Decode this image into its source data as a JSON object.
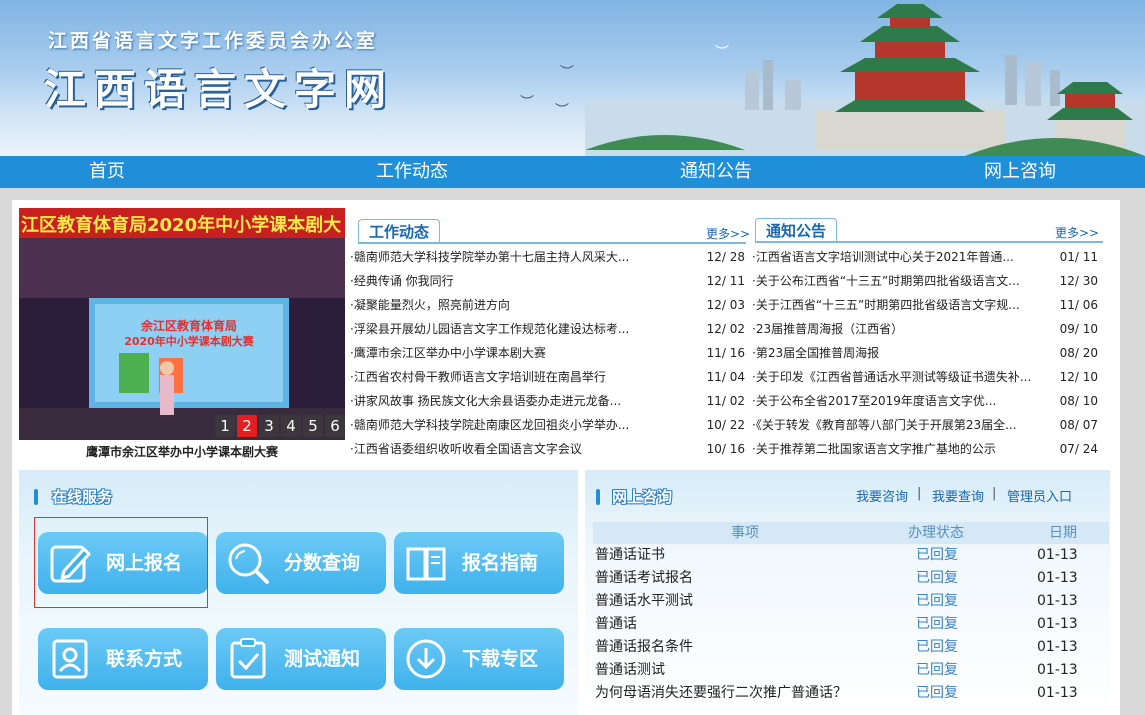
{
  "banner": {
    "subtitle": "江西省语言文字工作委员会办公室",
    "title": "江西语言文字网"
  },
  "nav": [
    "首页",
    "工作动态",
    "通知公告",
    "网上咨询"
  ],
  "slider": {
    "caption": "鹰潭市余江区举办中小学课本剧大赛",
    "image_headline": "江区教育体育局2020年中小学课本剧大",
    "board_line1": "余江区教育体育局",
    "board_line2": "2020年中小学课本剧大赛",
    "pages": [
      "1",
      "2",
      "3",
      "4",
      "5",
      "6"
    ],
    "active_page": "2"
  },
  "work_news": {
    "tab": "工作动态",
    "more": "更多>>",
    "items": [
      {
        "title": "·赣南师范大学科技学院举办第十七届主持人风采大...",
        "date": "12/ 28"
      },
      {
        "title": "·经典传诵 你我同行",
        "date": "12/ 11"
      },
      {
        "title": "·凝聚能量烈火，照亮前进方向",
        "date": "12/ 03"
      },
      {
        "title": "·浮梁县开展幼儿园语言文字工作规范化建设达标考...",
        "date": "12/ 02"
      },
      {
        "title": "·鹰潭市余江区举办中小学课本剧大赛",
        "date": "11/ 16"
      },
      {
        "title": "·江西省农村骨干教师语言文字培训班在南昌举行",
        "date": "11/ 04"
      },
      {
        "title": "·讲家风故事 扬民族文化大余县语委办走进元龙备...",
        "date": "11/ 02"
      },
      {
        "title": "·赣南师范大学科技学院赴南康区龙回祖炎小学举办...",
        "date": "10/ 22"
      },
      {
        "title": "·江西省语委组织收听收看全国语言文字会议",
        "date": "10/ 16"
      }
    ]
  },
  "notice": {
    "tab": "通知公告",
    "more": "更多>>",
    "items": [
      {
        "title": "·江西省语言文字培训测试中心关于2021年普通...",
        "date": "01/ 11"
      },
      {
        "title": "·关于公布江西省“十三五”时期第四批省级语言文...",
        "date": "12/ 30"
      },
      {
        "title": "·关于江西省“十三五”时期第四批省级语言文字规...",
        "date": "11/ 06"
      },
      {
        "title": "·23届推普周海报（江西省）",
        "date": "09/ 10"
      },
      {
        "title": "·第23届全国推普周海报",
        "date": "08/ 20"
      },
      {
        "title": "·关于印发《江西省普通话水平测试等级证书遗失补...",
        "date": "12/ 10"
      },
      {
        "title": "·关于公布全省2017至2019年度语言文字优...",
        "date": "08/ 10"
      },
      {
        "title": "·《关于转发《教育部等八部门关于开展第23届全...",
        "date": "08/ 07"
      },
      {
        "title": "·关于推荐第二批国家语言文字推广基地的公示",
        "date": "07/ 24"
      }
    ]
  },
  "online_service": {
    "title": "在线服务",
    "buttons": [
      {
        "label": "网上报名",
        "icon": "pencil-icon"
      },
      {
        "label": "分数查询",
        "icon": "magnifier-icon"
      },
      {
        "label": "报名指南",
        "icon": "book-icon"
      },
      {
        "label": "联系方式",
        "icon": "contact-card-icon"
      },
      {
        "label": "测试通知",
        "icon": "clipboard-check-icon"
      },
      {
        "label": "下载专区",
        "icon": "download-icon"
      }
    ]
  },
  "consult": {
    "title": "网上咨询",
    "links": [
      "我要咨询",
      "我要查询",
      "管理员入口"
    ],
    "headers": [
      "事项",
      "办理状态",
      "日期"
    ],
    "rows": [
      {
        "item": "普通话证书",
        "status": "已回复",
        "date": "01-13"
      },
      {
        "item": "普通话考试报名",
        "status": "已回复",
        "date": "01-13"
      },
      {
        "item": "普通话水平测试",
        "status": "已回复",
        "date": "01-13"
      },
      {
        "item": "普通话",
        "status": "已回复",
        "date": "01-13"
      },
      {
        "item": "普通话报名条件",
        "status": "已回复",
        "date": "01-13"
      },
      {
        "item": "普通话测试",
        "status": "已回复",
        "date": "01-13"
      },
      {
        "item": "为何母语消失还要强行二次推广普通话？",
        "status": "已回复",
        "date": "01-13"
      }
    ]
  },
  "colors": {
    "nav": "#1e8fd8",
    "accent": "#1a67b0",
    "button": "#3fb1ec",
    "active_page": "#e02020"
  }
}
